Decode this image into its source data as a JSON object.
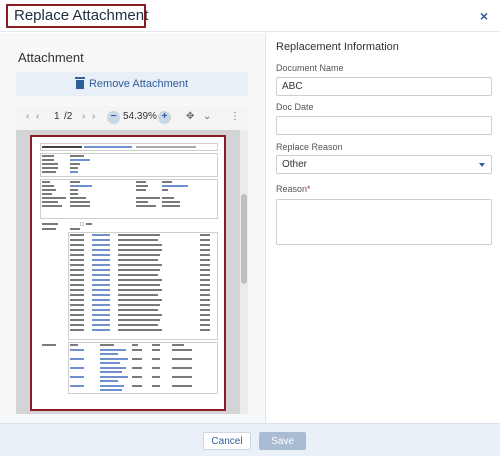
{
  "header": {
    "title": "Replace Attachment",
    "close_label": "×"
  },
  "attachment": {
    "heading": "Attachment",
    "remove_label": "Remove Attachment",
    "viewer": {
      "page_current": "1",
      "page_total": "/2",
      "zoom": "54.39%",
      "zoom_out_label": "−",
      "zoom_in_label": "+"
    }
  },
  "replacement": {
    "title": "Replacement Information",
    "document_name_label": "Document Name",
    "document_name_value": "ABC",
    "doc_date_label": "Doc Date",
    "doc_date_value": "",
    "reason_select_label": "Replace Reason",
    "reason_select_value": "Other",
    "reason_label": "Reason",
    "reason_required_mark": "*",
    "reason_value": ""
  },
  "footer": {
    "cancel_label": "Cancel",
    "save_label": "Save"
  },
  "colors": {
    "accent": "#2f5f9b",
    "highlight_border": "#8b1c24",
    "footer_bg": "#eaf0f7"
  },
  "icons": [
    "close-icon",
    "trash-icon",
    "chevron-left-icon",
    "chevron-right-icon",
    "zoom-out-icon",
    "zoom-in-icon",
    "fit-icon",
    "chevron-down-icon",
    "more-icon"
  ]
}
